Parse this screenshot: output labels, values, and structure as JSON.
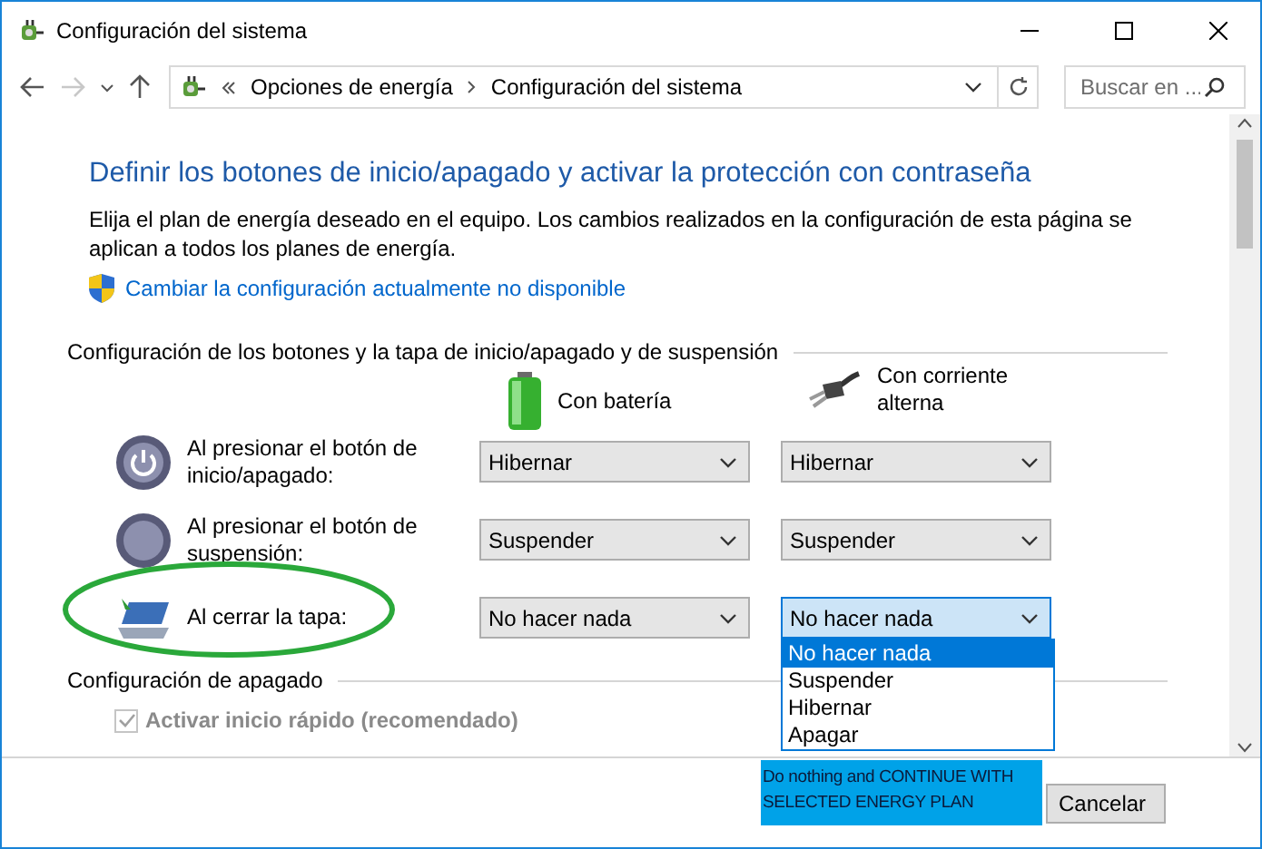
{
  "window": {
    "title": "Configuración del sistema"
  },
  "nav": {
    "breadcrumbs": [
      "Opciones de energía",
      "Configuración del sistema"
    ],
    "search": {
      "placeholder": "Buscar en ..."
    }
  },
  "page": {
    "heading": "Definir los botones de inicio/apagado y activar la protección con contraseña",
    "description": "Elija el plan de energía deseado en el equipo. Los cambios realizados en la configuración de esta página se aplican a todos los planes de energía.",
    "admin_link": "Cambiar la configuración actualmente no disponible"
  },
  "power_section": {
    "title": "Configuración de los botones y la tapa de inicio/apagado y de suspensión",
    "columns": [
      "Con batería",
      "Con corriente alterna"
    ],
    "rows": [
      {
        "kind": "power",
        "label": "Al presionar el botón de inicio/apagado:",
        "battery": "Hibernar",
        "ac": "Hibernar",
        "open": false
      },
      {
        "kind": "sleep",
        "label": "Al presionar el botón de suspensión:",
        "battery": "Suspender",
        "ac": "Suspender",
        "open": false
      },
      {
        "kind": "lid",
        "label": "Al cerrar la tapa:",
        "battery": "No hacer nada",
        "ac": "No hacer nada",
        "open": true,
        "circled": true
      }
    ]
  },
  "dropdown_options": [
    {
      "label": "No hacer nada",
      "selected": true
    },
    {
      "label": "Suspender",
      "selected": false
    },
    {
      "label": "Hibernar",
      "selected": false
    },
    {
      "label": "Apagar",
      "selected": false
    }
  ],
  "shutdown_section": {
    "title": "Configuración de apagado",
    "options": [
      {
        "label": "Activar inicio rápido (recomendado)",
        "checked": true,
        "disabled": true
      }
    ]
  },
  "annotation": {
    "text": "Do nothing and CONTINUE WITH SELECTED ENERGY PLAN"
  },
  "buttons": [
    "Cancelar"
  ]
}
